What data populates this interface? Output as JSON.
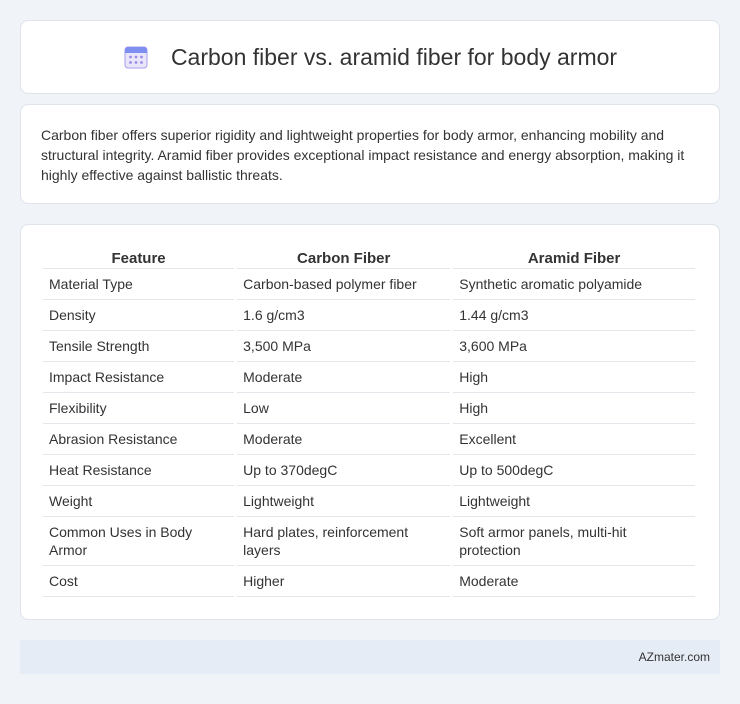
{
  "header": {
    "title": "Carbon fiber vs. aramid fiber for body armor",
    "icon": "calendar-icon"
  },
  "intro": {
    "text": "Carbon fiber offers superior rigidity and lightweight properties for body armor, enhancing mobility and structural integrity. Aramid fiber provides exceptional impact resistance and energy absorption, making it highly effective against ballistic threats."
  },
  "table": {
    "headers": [
      "Feature",
      "Carbon Fiber",
      "Aramid Fiber"
    ],
    "rows": [
      [
        "Material Type",
        "Carbon-based polymer fiber",
        "Synthetic aromatic polyamide"
      ],
      [
        "Density",
        "1.6 g/cm3",
        "1.44 g/cm3"
      ],
      [
        "Tensile Strength",
        "3,500 MPa",
        "3,600 MPa"
      ],
      [
        "Impact Resistance",
        "Moderate",
        "High"
      ],
      [
        "Flexibility",
        "Low",
        "High"
      ],
      [
        "Abrasion Resistance",
        "Moderate",
        "Excellent"
      ],
      [
        "Heat Resistance",
        "Up to 370degC",
        "Up to 500degC"
      ],
      [
        "Weight",
        "Lightweight",
        "Lightweight"
      ],
      [
        "Common Uses in Body Armor",
        "Hard plates, reinforcement layers",
        "Soft armor panels, multi-hit protection"
      ],
      [
        "Cost",
        "Higher",
        "Moderate"
      ]
    ]
  },
  "footer": {
    "text": "AZmater.com"
  }
}
